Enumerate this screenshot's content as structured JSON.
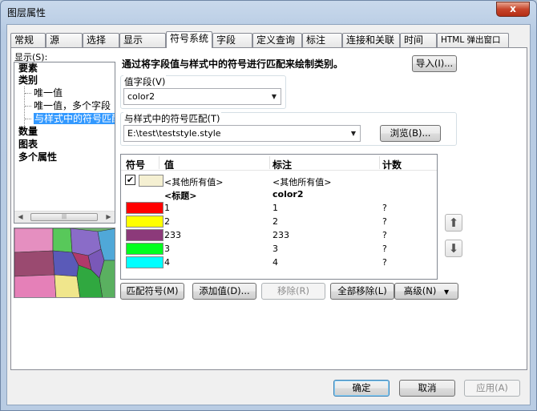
{
  "window": {
    "title": "图层属性",
    "close_glyph": "x"
  },
  "tabs": [
    {
      "label": "常规"
    },
    {
      "label": "源"
    },
    {
      "label": "选择"
    },
    {
      "label": "显示"
    },
    {
      "label": "符号系统"
    },
    {
      "label": "字段"
    },
    {
      "label": "定义查询"
    },
    {
      "label": "标注"
    },
    {
      "label": "连接和关联"
    },
    {
      "label": "时间"
    },
    {
      "label": "HTML 弹出窗口"
    }
  ],
  "show": {
    "label": "显示(S):",
    "tree": [
      {
        "label": "要素"
      },
      {
        "label": "类别"
      },
      {
        "label": "唯一值"
      },
      {
        "label": "唯一值，多个字段"
      },
      {
        "label": "与样式中的符号匹配"
      },
      {
        "label": "数量"
      },
      {
        "label": "图表"
      },
      {
        "label": "多个属性"
      }
    ]
  },
  "description": "通过将字段值与样式中的符号进行匹配来绘制类别。",
  "import_button": "导入(I)...",
  "value_field": {
    "label": "值字段(V)",
    "value": "color2"
  },
  "style_match": {
    "label": "与样式中的符号匹配(T)",
    "value": "E:\\test\\teststyle.style",
    "browse_button": "浏览(B)..."
  },
  "grid": {
    "headers": {
      "symbol": "符号",
      "value": "值",
      "label": "标注",
      "count": "计数"
    },
    "all_other": {
      "value": "<其他所有值>",
      "label": "<其他所有值>",
      "color": "#f5f0d2"
    },
    "heading_row": {
      "value": "<标题>",
      "label": "color2"
    },
    "rows": [
      {
        "color": "#ff0000",
        "value": "1",
        "label": "1",
        "count": "?"
      },
      {
        "color": "#ffff00",
        "value": "2",
        "label": "2",
        "count": "?"
      },
      {
        "color": "#8c3a7a",
        "value": "233",
        "label": "233",
        "count": "?"
      },
      {
        "color": "#00ff1e",
        "value": "3",
        "label": "3",
        "count": "?"
      },
      {
        "color": "#00ffff",
        "value": "4",
        "label": "4",
        "count": "?"
      }
    ]
  },
  "actions": {
    "match_symbols": "匹配符号(M)",
    "add_values": "添加值(D)...",
    "remove": "移除(R)",
    "remove_all": "全部移除(L)",
    "advanced": "高级(N)"
  },
  "footer": {
    "ok": "确定",
    "cancel": "取消",
    "apply": "应用(A)"
  }
}
